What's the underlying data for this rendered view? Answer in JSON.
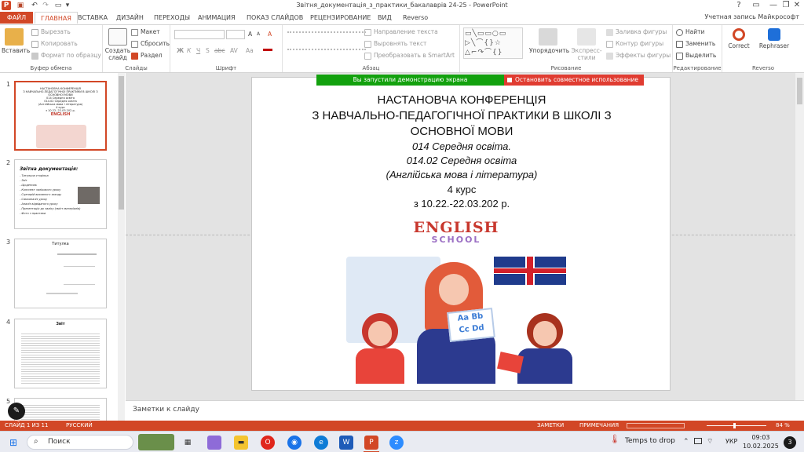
{
  "window": {
    "title": "Звітня_документація_з_практики_бакалаврів 24-25 - PowerPoint",
    "account": "Учетная запись Майкрософт",
    "help": "?",
    "ribbon_toggle": "▭",
    "min": "—",
    "restore": "❐",
    "close": "✕"
  },
  "quick_access": [
    "save-icon",
    "undo-icon",
    "redo-icon",
    "start-from-beginning-icon"
  ],
  "tabs": [
    "ФАЙЛ",
    "ГЛАВНАЯ",
    "ВСТАВКА",
    "ДИЗАЙН",
    "ПЕРЕХОДЫ",
    "АНИМАЦИЯ",
    "ПОКАЗ СЛАЙДОВ",
    "РЕЦЕНЗИРОВАНИЕ",
    "ВИД",
    "Reverso"
  ],
  "ribbon": {
    "clipboard": {
      "name": "Буфер обмена",
      "paste": "Вставить",
      "cut": "Вырезать",
      "copy": "Копировать",
      "format_painter": "Формат по образцу"
    },
    "slides": {
      "name": "Слайды",
      "new_slide": "Создать слайд",
      "layout": "Макет",
      "reset": "Сбросить",
      "section": "Раздел"
    },
    "font": {
      "name": "Шрифт",
      "bold": "Ж",
      "italic": "К",
      "underline": "Ч",
      "strike": "S",
      "shadow": "abc",
      "spacing": "AV",
      "case": "Aa",
      "grow": "A",
      "shrink": "A",
      "clear": "A"
    },
    "paragraph": {
      "name": "Абзац",
      "text_direction": "Направление текста",
      "align_text": "Выровнять текст",
      "smartart": "Преобразовать в SmartArt"
    },
    "drawing": {
      "name": "Рисование",
      "arrange": "Упорядочить",
      "quick_styles": "Экспресс-стили",
      "fill": "Заливка фигуры",
      "outline": "Контур фигуры",
      "effects": "Эффекты фигуры"
    },
    "editing": {
      "name": "Редактирование",
      "find": "Найти",
      "replace": "Заменить",
      "select": "Выделить"
    },
    "reverso": {
      "name": "Reverso",
      "correct": "Correct",
      "rephraser": "Rephraser"
    }
  },
  "thumbnails": [
    {
      "num": "1",
      "lines": [
        "НАСТАНОВЧА КОНФЕРЕНЦІЯ",
        "З НАВЧАЛЬНО-ПЕДАГОГІЧНОЇ ПРАКТИКИ В ШКОЛІ З ОСНОВНОЇ МОВИ",
        "014 Середня освіта",
        "014.02 Середня освіта",
        "(Англійська мова і література)",
        "4 курс",
        "з 10.22.-22.03.202 р."
      ],
      "badge": "ENGLISH"
    },
    {
      "num": "2",
      "title": "Звітна документація:",
      "items": [
        "- Титульна сторінка",
        "- Звіт",
        "- Щоденник",
        "- Конспект залікового уроку",
        "- Сценарій виховного заходу",
        "- Самоаналіз уроку",
        "- Аналіз відвіданого уроку",
        "- Презентація до заліку (зміст матеріалів)",
        "- Фото з практики"
      ]
    },
    {
      "num": "3",
      "title": "Титулка"
    },
    {
      "num": "4",
      "title": "Звіт"
    },
    {
      "num": "5"
    }
  ],
  "share_banner": {
    "active": "Вы запустили демонстрацию экрана",
    "stop": "Остановить совместное использование"
  },
  "slide": {
    "line1": "НАСТАНОВЧА КОНФЕРЕНЦІЯ",
    "line2": "З НАВЧАЛЬНО-ПЕДАГОГІЧНОЇ ПРАКТИКИ В ШКОЛІ З",
    "line3": "ОСНОВНОЇ МОВИ",
    "line4": "014 Середня освіта.",
    "line5": "014.02 Середня освіта",
    "line6": "(Англійська мова і література)",
    "line7": "4 курс",
    "line8": "з 10.22.-22.03.202 р.",
    "logo_main": "ENGLISH",
    "logo_sub": "SCHOOL",
    "card_text1": "Aa Bb",
    "card_text2": "Cc Dd"
  },
  "notes_placeholder": "Заметки к слайду",
  "status": {
    "slide": "СЛАЙД 1 ИЗ 11",
    "lang": "РУССКИЙ",
    "notes": "ЗАМЕТКИ",
    "comments": "ПРИМЕЧАНИЯ",
    "zoom": "84 %"
  },
  "taskbar": {
    "search": "Поиск",
    "weather": "Temps to drop",
    "lang": "УКР",
    "time": "09:03",
    "date": "10.02.2025",
    "notif": "3"
  },
  "colors": {
    "accent": "#d24726",
    "green": "#13a10e",
    "red": "#e03c31"
  }
}
